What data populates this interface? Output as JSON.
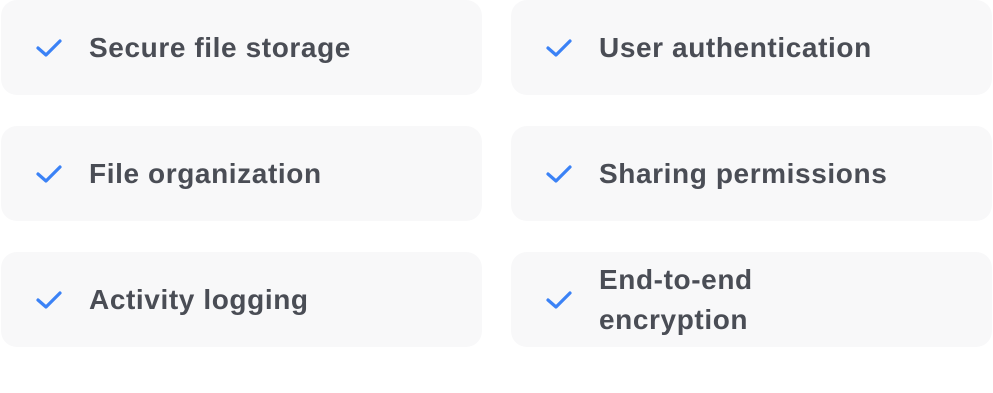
{
  "colors": {
    "accent": "#3b82f6",
    "card_background": "#f8f8f9",
    "text": "#4a4d55"
  },
  "features": [
    {
      "label": "Secure file storage",
      "icon": "check-icon"
    },
    {
      "label": "User authentication",
      "icon": "check-icon"
    },
    {
      "label": "File organization",
      "icon": "check-icon"
    },
    {
      "label": "Sharing permissions",
      "icon": "check-icon"
    },
    {
      "label": "Activity logging",
      "icon": "check-icon"
    },
    {
      "label": "End-to-end encryption",
      "icon": "check-icon"
    }
  ]
}
